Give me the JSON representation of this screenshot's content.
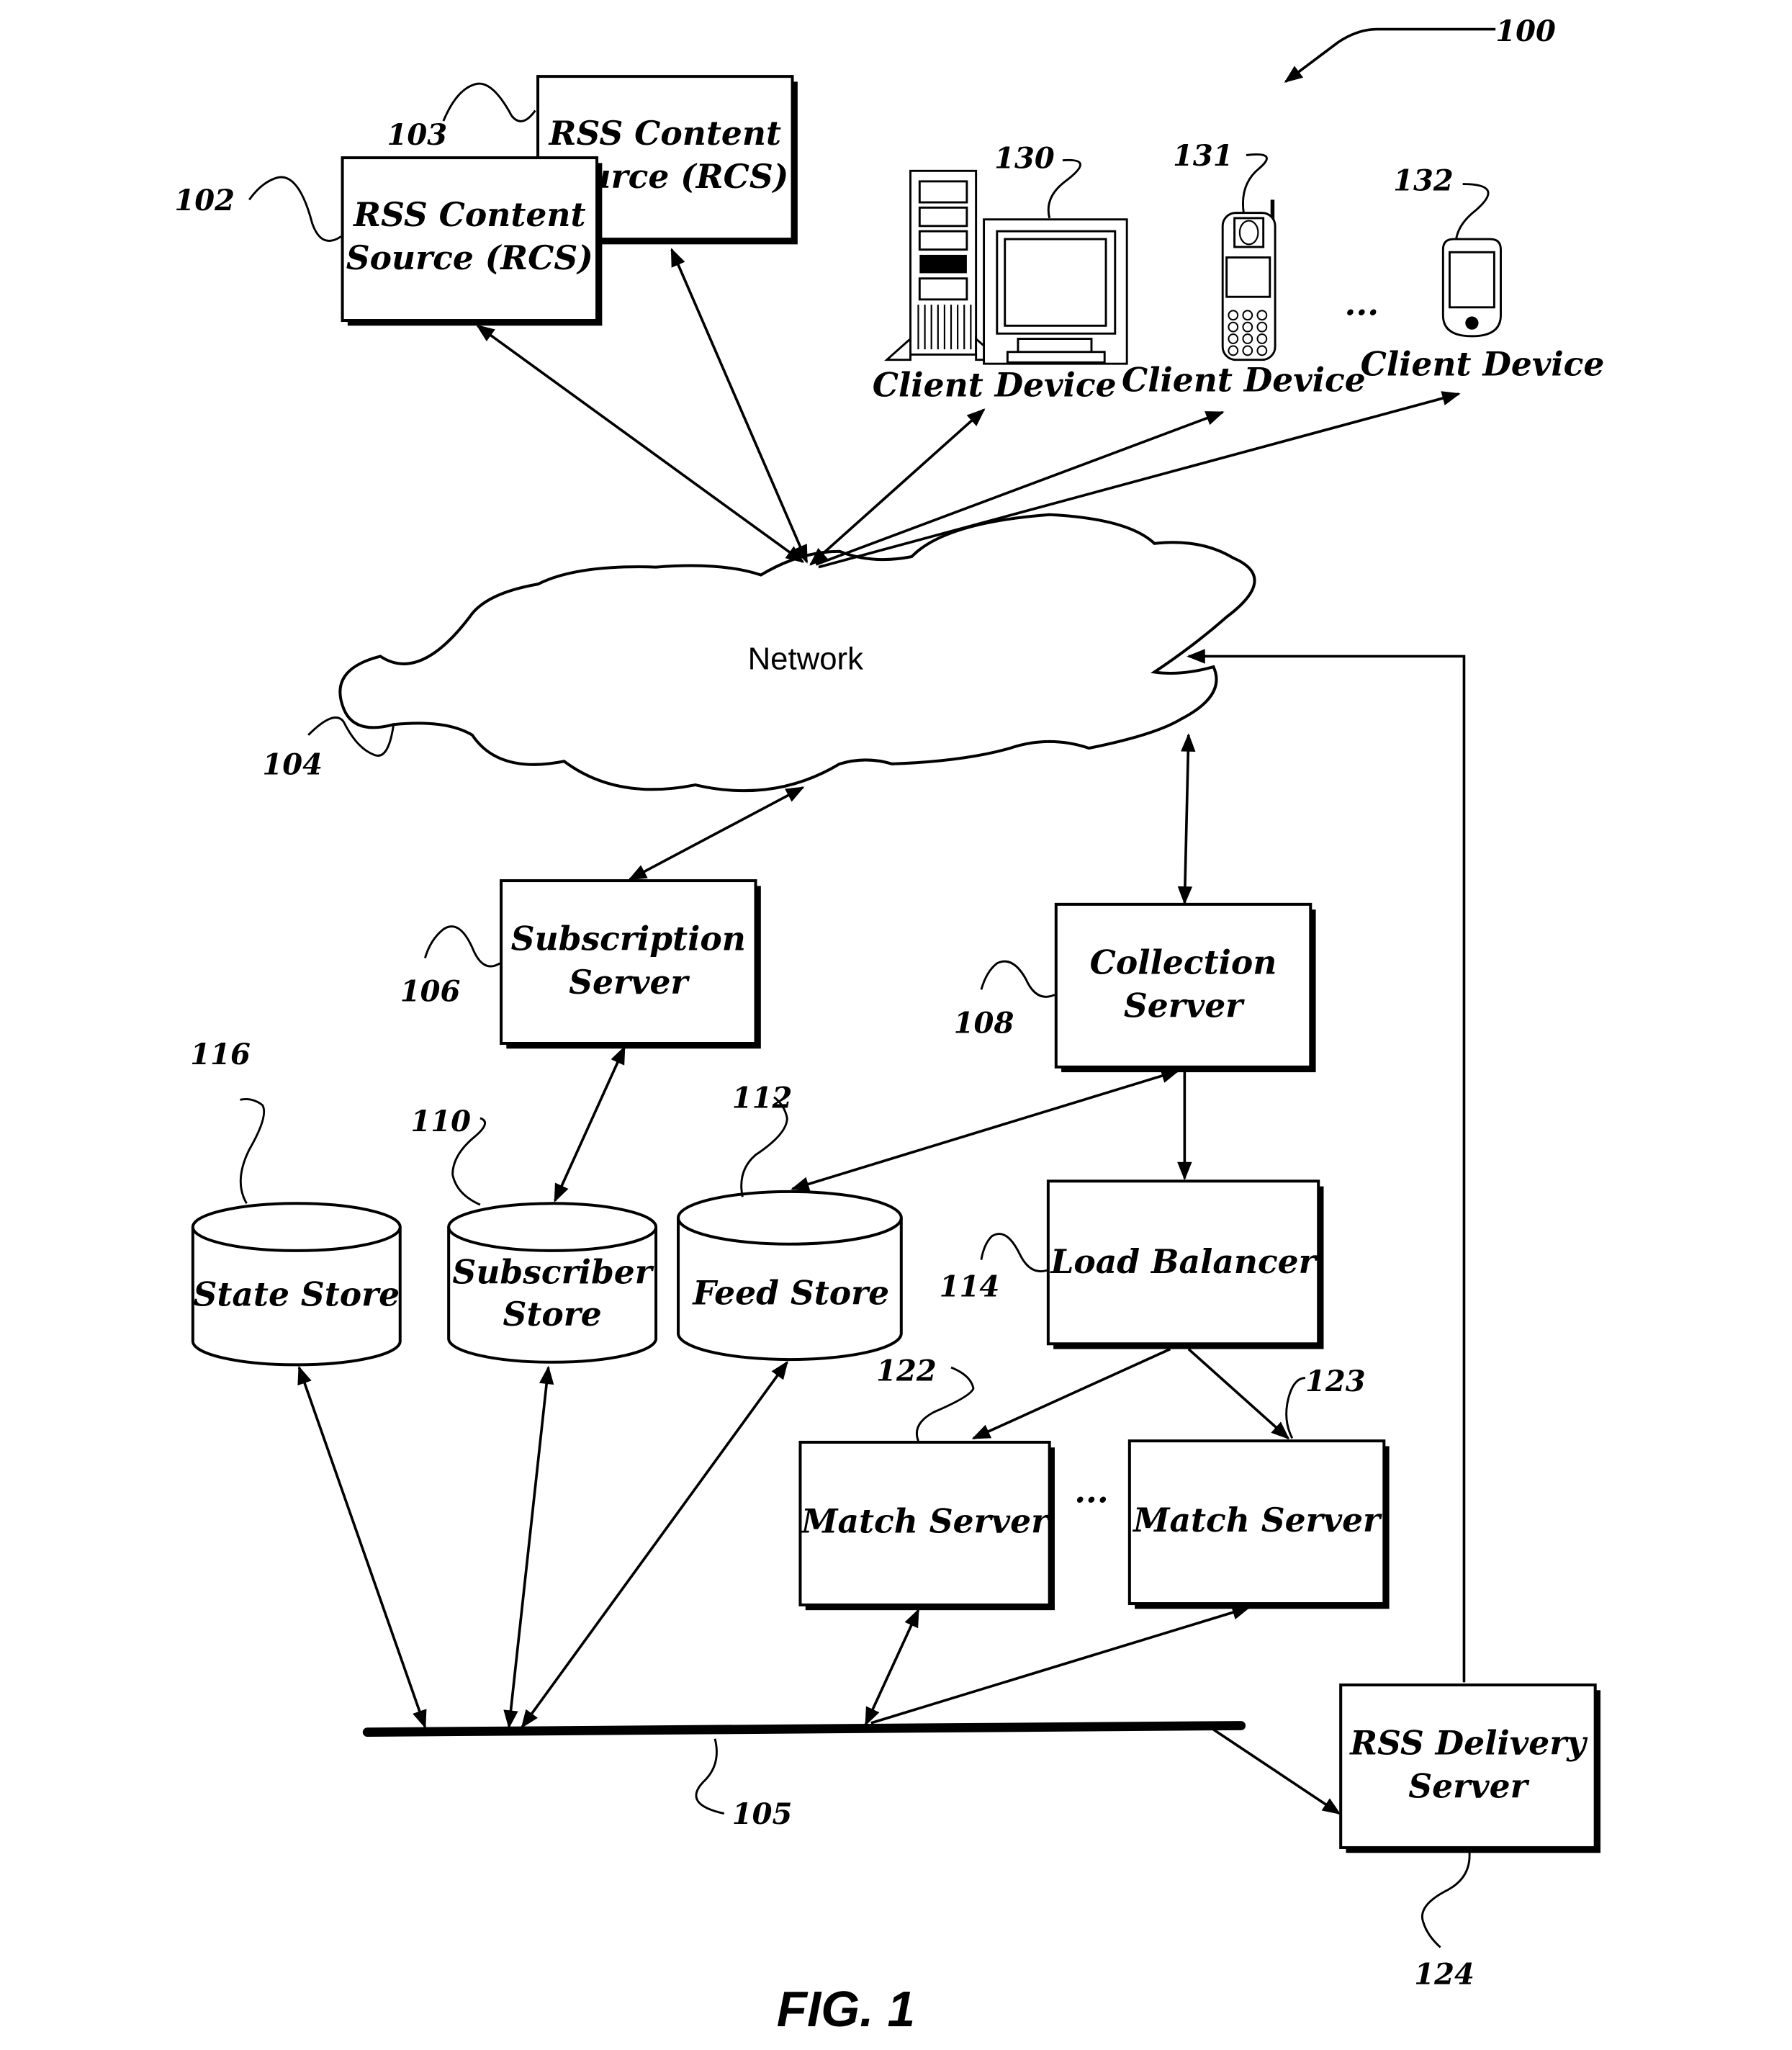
{
  "figure": {
    "caption": "FIG. 1",
    "system_ref": "100"
  },
  "network": {
    "label": "Network",
    "ref": "104"
  },
  "content_sources": [
    {
      "line1": "RSS Content",
      "line2": "Source (RCS)",
      "ref": "102"
    },
    {
      "line1": "RSS Content",
      "line2": "Source (RCS)",
      "ref": "103"
    }
  ],
  "clients": [
    {
      "label": "Client Device",
      "ref": "130",
      "icon": "desktop-computer-icon"
    },
    {
      "label": "Client Device",
      "ref": "131",
      "icon": "mobile-phone-icon"
    },
    {
      "label": "Client Device",
      "ref": "132",
      "icon": "pda-icon"
    }
  ],
  "ellipsis": "...",
  "servers": {
    "subscription": {
      "line1": "Subscription",
      "line2": "Server",
      "ref": "106"
    },
    "collection": {
      "line1": "Collection",
      "line2": "Server",
      "ref": "108"
    },
    "load_balancer": {
      "label": "Load Balancer",
      "ref": "114"
    },
    "match_1": {
      "label": "Match Server",
      "ref": "122"
    },
    "match_2": {
      "label": "Match Server",
      "ref": "123"
    },
    "delivery": {
      "line1": "RSS Delivery",
      "line2": "Server",
      "ref": "124"
    }
  },
  "stores": {
    "state": {
      "label": "State Store",
      "ref": "116"
    },
    "subscriber": {
      "line1": "Subscriber",
      "line2": "Store",
      "ref": "110"
    },
    "feed": {
      "label": "Feed Store",
      "ref": "112"
    }
  },
  "bus": {
    "ref": "105"
  }
}
